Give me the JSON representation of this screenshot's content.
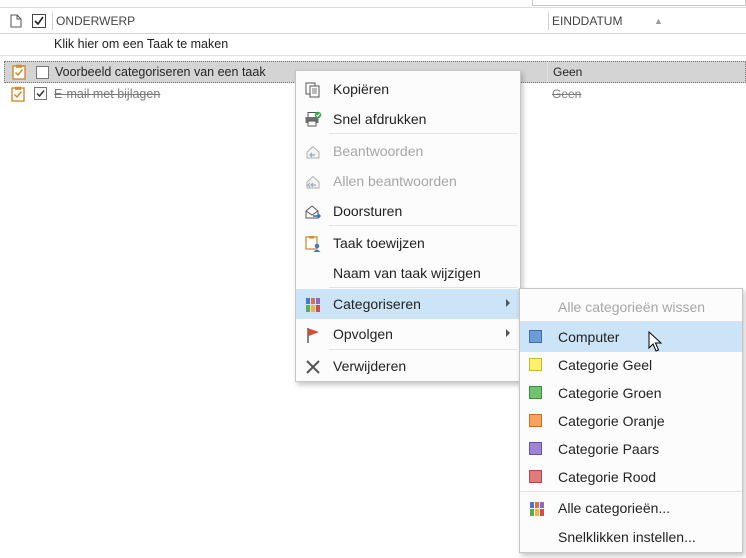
{
  "header": {
    "col_subject": "ONDERWERP",
    "col_due": "EINDDATUM"
  },
  "new_task_prompt": "Klik hier om een Taak te maken",
  "tasks": [
    {
      "subject": "Voorbeeld categoriseren van een taak",
      "due": "Geen",
      "completed": false
    },
    {
      "subject": "E-mail met bijlagen",
      "due": "Geen",
      "completed": true
    }
  ],
  "context_menu": {
    "copy": "Kopiëren",
    "quick_print": "Snel afdrukken",
    "reply": "Beantwoorden",
    "reply_all": "Allen beantwoorden",
    "forward": "Doorsturen",
    "assign_task": "Taak toewijzen",
    "rename_task": "Naam van taak wijzigen",
    "categorize": "Categoriseren",
    "follow_up": "Opvolgen",
    "delete": "Verwijderen"
  },
  "categorize_submenu": {
    "clear_all": "Alle categorieën wissen",
    "categories": [
      {
        "name": "Computer",
        "color": "#6c9bd8",
        "border": "#3c6db5"
      },
      {
        "name": "Categorie Geel",
        "color": "#fff170",
        "border": "#c9b52e"
      },
      {
        "name": "Categorie Groen",
        "color": "#70c36a",
        "border": "#3f8f3a"
      },
      {
        "name": "Categorie Oranje",
        "color": "#f4a361",
        "border": "#c96c26"
      },
      {
        "name": "Categorie Paars",
        "color": "#9b86d6",
        "border": "#6650ad"
      },
      {
        "name": "Categorie Rood",
        "color": "#e07b7b",
        "border": "#b04848"
      }
    ],
    "all_categories": "Alle categorieën...",
    "quick_click": "Snelklikken instellen..."
  }
}
